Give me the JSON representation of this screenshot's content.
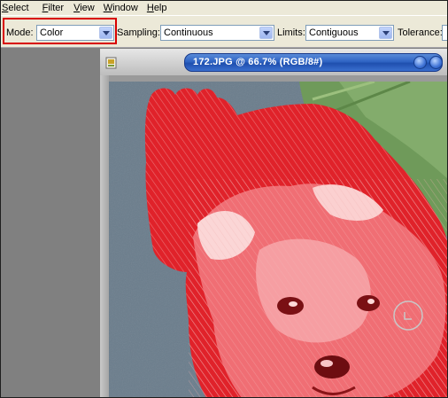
{
  "menubar": {
    "items": [
      {
        "label": "Select",
        "u": "S",
        "rest": "elect"
      },
      {
        "label": "Filter",
        "u": "F",
        "rest": "ilter"
      },
      {
        "label": "View",
        "u": "V",
        "rest": "iew"
      },
      {
        "label": "Window",
        "u": "W",
        "rest": "indow"
      },
      {
        "label": "Help",
        "u": "H",
        "rest": "elp"
      }
    ]
  },
  "options": {
    "mode_label": "Mode:",
    "mode_value": "Color",
    "sampling_label": "Sampling:",
    "sampling_value": "Continuous",
    "limits_label": "Limits:",
    "limits_value": "Contiguous",
    "tolerance_label": "Tolerance:"
  },
  "document": {
    "title": "172.JPG @ 66.7% (RGB/8#)"
  },
  "colors": {
    "highlight": "#d80000",
    "titlebar": "#2f64c4",
    "overlay_red": "#e0222a"
  }
}
